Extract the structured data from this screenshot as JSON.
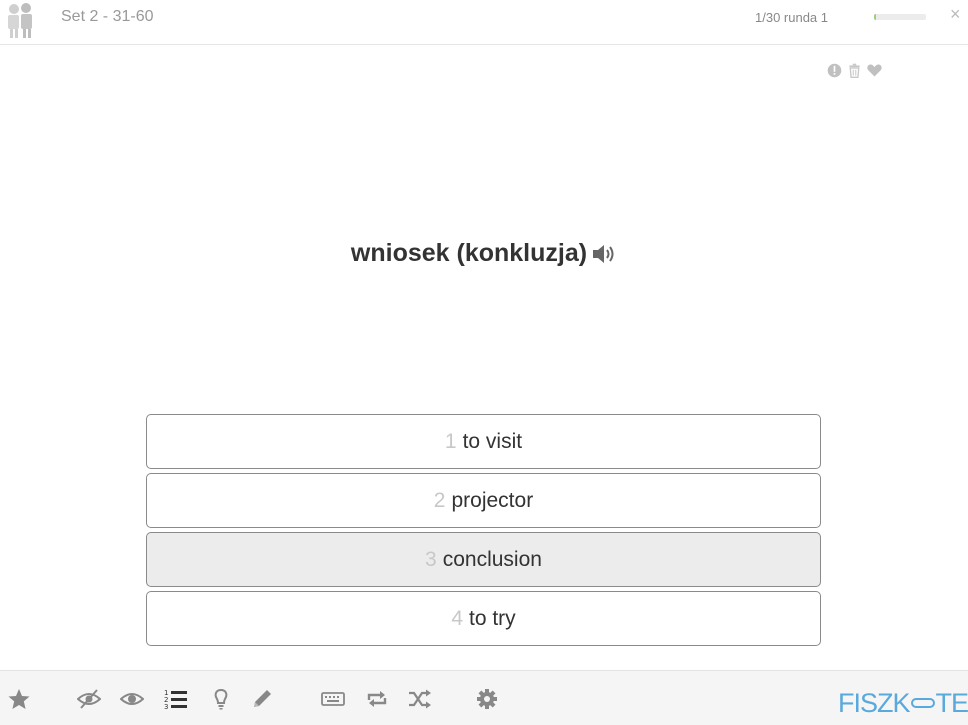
{
  "header": {
    "set_title": "Set 2 - 31-60",
    "progress_text": "1/30 runda 1",
    "progress_fraction": 0.033,
    "close_label": "×"
  },
  "card": {
    "word": "wniosek (konkluzja)",
    "actions": [
      "report-icon",
      "trash-icon",
      "heart-icon"
    ]
  },
  "answers": [
    {
      "num": "1",
      "text": "to visit",
      "selected": false
    },
    {
      "num": "2",
      "text": "projector",
      "selected": false
    },
    {
      "num": "3",
      "text": "conclusion",
      "selected": true
    },
    {
      "num": "4",
      "text": "to try",
      "selected": false
    }
  ],
  "toolbar": {
    "items": [
      "star-icon",
      "hide-eye-icon",
      "eye-icon",
      "numbered-list-icon",
      "lightbulb-icon",
      "pencil-icon",
      "keyboard-icon",
      "repeat-icon",
      "shuffle-icon",
      "gear-icon"
    ]
  },
  "logo": {
    "left": "FISZK",
    "right": "TEKA",
    "color": "#5aa9dc"
  },
  "colors": {
    "selected_answer_bg": "#ececec",
    "answer_border": "#8a8a8a",
    "icon_gray": "#888888",
    "progress_fill": "#9ed07a"
  }
}
